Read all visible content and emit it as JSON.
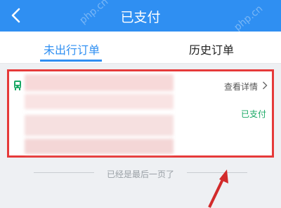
{
  "header": {
    "title": "已支付",
    "back_icon": "chevron-left-icon",
    "color": "#2f8ff2"
  },
  "tabs": [
    {
      "label": "未出行订单",
      "active": true
    },
    {
      "label": "历史订单",
      "active": false
    }
  ],
  "order_card": {
    "transport_icon": "bus-icon",
    "detail_link": "查看详情",
    "detail_chevron": "chevron-right-icon",
    "status": "已支付",
    "status_color": "#18a864",
    "highlight_color": "#e63a3a"
  },
  "footer": {
    "end_text": "已经是最后一页了"
  },
  "annotation": {
    "arrow_color": "#d22b2b"
  },
  "watermark": "php.cn"
}
